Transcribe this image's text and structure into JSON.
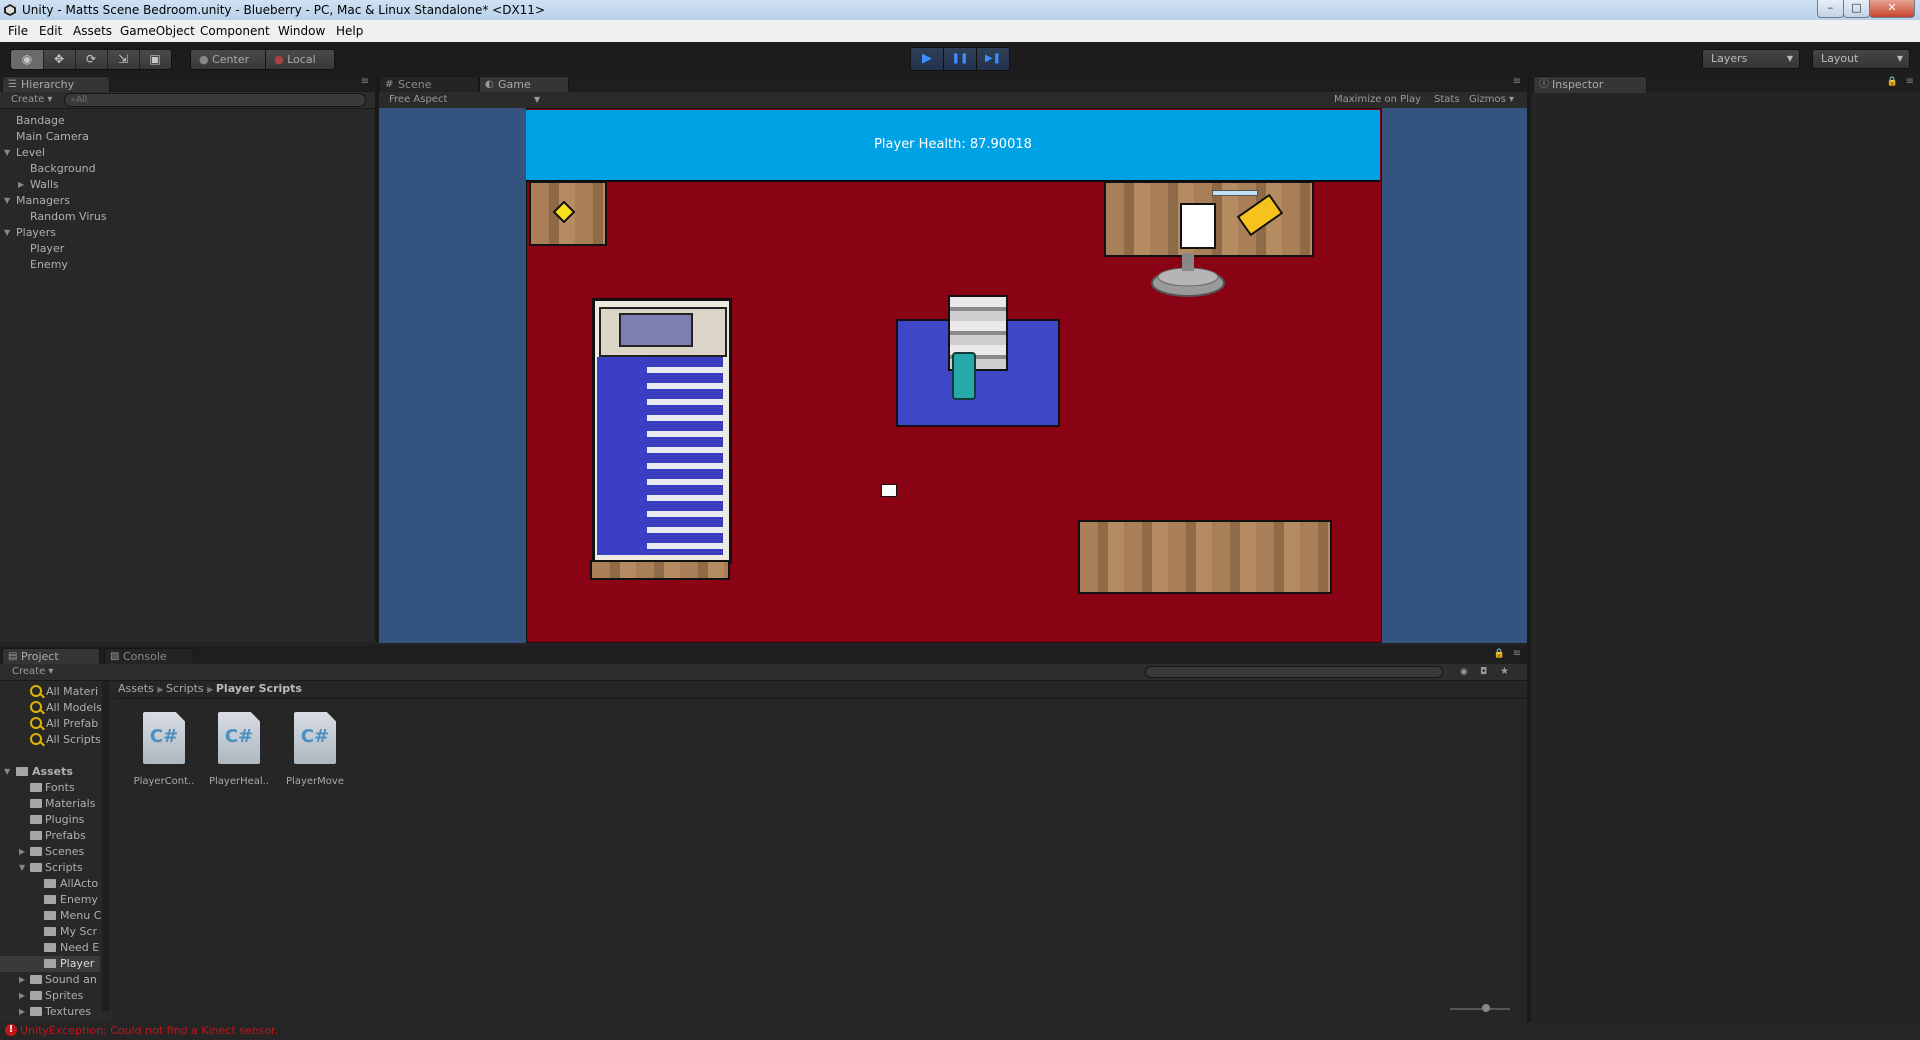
{
  "window": {
    "title": "Unity - Matts Scene Bedroom.unity - Blueberry - PC, Mac & Linux Standalone* <DX11>",
    "minimize": "–",
    "maximize": "□",
    "close": "✕"
  },
  "menu": [
    "File",
    "Edit",
    "Assets",
    "GameObject",
    "Component",
    "Window",
    "Help"
  ],
  "toolbar": {
    "pivot": "Center",
    "space": "Local",
    "layers": "Layers",
    "layout": "Layout",
    "play": "▶",
    "pause": "❚❚",
    "step": "▶❚"
  },
  "hierarchy": {
    "tab": "Hierarchy",
    "create": "Create ▾",
    "search_placeholder": "⌕All",
    "items": {
      "bandage": "Bandage",
      "main_camera": "Main Camera",
      "level": "Level",
      "background": "Background",
      "walls": "Walls",
      "managers": "Managers",
      "random_virus": "Random Virus",
      "players": "Players",
      "player": "Player",
      "enemy": "Enemy"
    }
  },
  "scene_tab": "Scene",
  "game": {
    "tab": "Game",
    "aspect": "Free Aspect",
    "maximize_on_play": "Maximize on Play",
    "stats": "Stats",
    "gizmos": "Gizmos ▾",
    "health_text": "Player Health:  87.90018"
  },
  "inspector": {
    "tab": "Inspector"
  },
  "project": {
    "tab": "Project",
    "console_tab": "Console",
    "create": "Create ▾",
    "favorites": [
      "All Materi",
      "All Models",
      "All Prefab",
      "All Scripts"
    ],
    "assets_root": "Assets",
    "folders": {
      "fonts": "Fonts",
      "materials": "Materials",
      "plugins": "Plugins",
      "prefabs": "Prefabs",
      "scenes": "Scenes",
      "scripts": "Scripts",
      "allacto": "AllActo",
      "enemy": "Enemy",
      "menu": "Menu C",
      "myscr": "My Scr",
      "neede": "Need E",
      "player": "Player",
      "sound": "Sound an",
      "sprites": "Sprites",
      "textures": "Textures"
    },
    "breadcrumb": [
      "Assets",
      "Scripts",
      "Player Scripts"
    ],
    "files": [
      {
        "name": "PlayerCont..",
        "glyph": "C#"
      },
      {
        "name": "PlayerHeal..",
        "glyph": "C#"
      },
      {
        "name": "PlayerMove",
        "glyph": "C#"
      }
    ]
  },
  "status": {
    "icon": "!",
    "message": "UnityException: Could not find a Kinect sensor."
  }
}
